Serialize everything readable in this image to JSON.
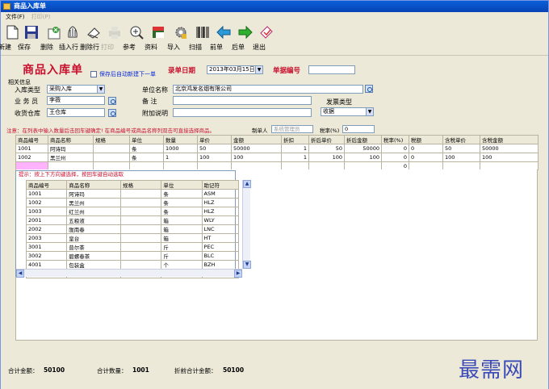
{
  "window": {
    "title": "商品入库单"
  },
  "menu": {
    "file": "文件(F)",
    "print": "打印(P)"
  },
  "toolbar": [
    {
      "label": "新建",
      "icon": "new-document-icon",
      "disabled": false
    },
    {
      "label": "保存",
      "icon": "save-floppy-icon",
      "disabled": false
    },
    {
      "label": "删除",
      "icon": "delete-icon",
      "disabled": false
    },
    {
      "label": "插入行",
      "icon": "insert-row-icon",
      "disabled": false
    },
    {
      "label": "删除行",
      "icon": "delete-row-icon",
      "disabled": false
    },
    {
      "label": "打印",
      "icon": "printer-icon",
      "disabled": true
    },
    {
      "label": "参考",
      "icon": "reference-icon",
      "disabled": false
    },
    {
      "label": "资料",
      "icon": "data-book-icon",
      "disabled": false
    },
    {
      "label": "导入",
      "icon": "import-gear-icon",
      "disabled": false
    },
    {
      "label": "扫描",
      "icon": "barcode-icon",
      "disabled": false
    },
    {
      "label": "前单",
      "icon": "arrow-left-icon",
      "disabled": false
    },
    {
      "label": "后单",
      "icon": "arrow-right-icon",
      "disabled": false
    },
    {
      "label": "退出",
      "icon": "exit-icon",
      "disabled": false
    }
  ],
  "form": {
    "heading": "商品入库单",
    "autonew_label": "保存后自动新建下一单",
    "date_label": "录单日期",
    "date_value": "2013年03月15日",
    "number_label": "单据编号",
    "number_value": "",
    "group_label": "相关信息",
    "in_type_label": "入库类型",
    "in_type_value": "采购入库",
    "staff_label": "业 务 员",
    "staff_value": "李薇",
    "warehouse_label": "收货仓库",
    "warehouse_value": "王仓库",
    "company_label": "单位名称",
    "company_value": "北京鸿发名烟有限公司",
    "remark_label": "备    注",
    "remark_value": "",
    "extra_label": "附加说明",
    "extra_value": "",
    "invoice_label": "发票类型",
    "invoice_value": "收据"
  },
  "hint": {
    "text": "注意：在列表中输入数量后击回车键确定! 在商品编号或商品名称列双击可直接选择商品。",
    "maker_label": "制单人",
    "maker_value": "系统管理员",
    "tax_label": "税率(%)",
    "tax_value": "0"
  },
  "grid": {
    "columns": [
      "商品编号",
      "商品名称",
      "规格",
      "单位",
      "数量",
      "单价",
      "金额",
      "折扣",
      "折后单价",
      "折后金额",
      "税率(%)",
      "税额",
      "含税单价",
      "含税金额"
    ],
    "rows": [
      [
        "1001",
        "阿诗玛",
        "",
        "条",
        "1000",
        "50",
        "50000",
        "1",
        "50",
        "50000",
        "0",
        "0",
        "50",
        "50000"
      ],
      [
        "1002",
        "黑兰州",
        "",
        "条",
        "1",
        "100",
        "100",
        "1",
        "100",
        "100",
        "0",
        "0",
        "100",
        "100"
      ],
      [
        "",
        "",
        "",
        "",
        "",
        "",
        "",
        "",
        "",
        "",
        "0",
        "",
        "",
        ""
      ]
    ]
  },
  "popup": {
    "title": "提示：按上下方向键选择，按回车键自动选取",
    "columns": [
      "商品编号",
      "商品名称",
      "规格",
      "单位",
      "助记符"
    ],
    "rows": [
      [
        "1001",
        "阿诗玛",
        "",
        "条",
        "ASM"
      ],
      [
        "1002",
        "黑兰州",
        "",
        "条",
        "HLZ"
      ],
      [
        "1003",
        "红兰州",
        "",
        "条",
        "HLZ"
      ],
      [
        "2001",
        "五粮液",
        "",
        "箱",
        "WLY"
      ],
      [
        "2002",
        "陇南春",
        "",
        "箱",
        "LNC"
      ],
      [
        "2003",
        "皇台",
        "",
        "箱",
        "HT"
      ],
      [
        "3001",
        "普尔茶",
        "",
        "斤",
        "PEC"
      ],
      [
        "3002",
        "碧螺春茶",
        "",
        "斤",
        "BLC"
      ],
      [
        "4001",
        "包装盒",
        "",
        "个",
        "BZH"
      ],
      [
        "4002",
        "",
        "",
        "个",
        "HSBZ"
      ]
    ]
  },
  "footer": {
    "total_amount_label": "合计金额：",
    "total_amount": "50100",
    "total_qty_label": "合计数量：",
    "total_qty": "1001",
    "disc_total_label": "折前合计金额：",
    "disc_total": "50100"
  },
  "watermark": "最需网"
}
